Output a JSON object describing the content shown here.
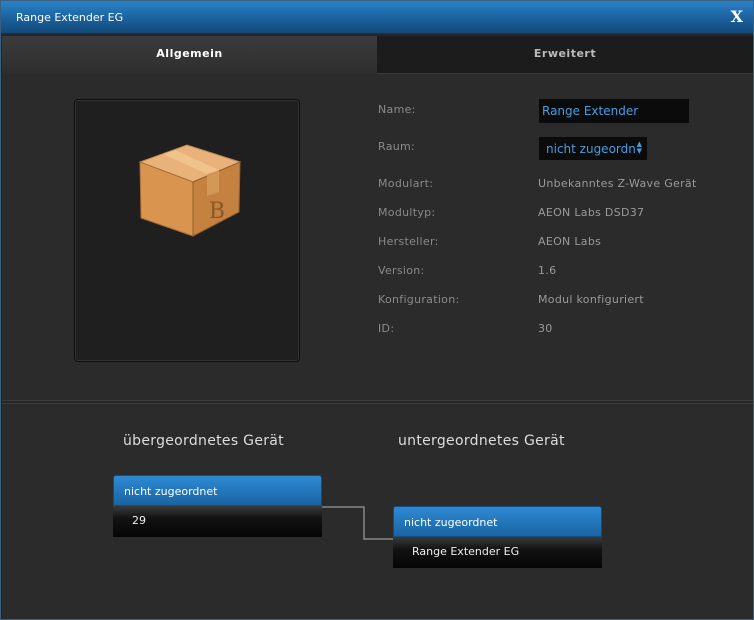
{
  "window": {
    "title": "Range Extender EG",
    "close_label": "X"
  },
  "tabs": [
    {
      "label": "Allgemein",
      "active": true
    },
    {
      "label": "Erweitert",
      "active": false
    }
  ],
  "icons": {
    "device_image": "package-box-icon"
  },
  "properties": {
    "name": {
      "label": "Name:",
      "value": "Range Extender"
    },
    "room": {
      "label": "Raum:",
      "value": "nicht zugeordn"
    },
    "modulart": {
      "label": "Modulart:",
      "value": "Unbekanntes Z-Wave Gerät"
    },
    "modultyp": {
      "label": "Modultyp:",
      "value": "AEON Labs DSD37"
    },
    "hersteller": {
      "label": "Hersteller:",
      "value": "AEON Labs"
    },
    "version": {
      "label": "Version:",
      "value": "1.6"
    },
    "konfiguration": {
      "label": "Konfiguration:",
      "value": "Modul konfiguriert"
    },
    "id": {
      "label": "ID:",
      "value": "30"
    }
  },
  "hierarchy": {
    "parent_heading": "übergeordnetes Gerät",
    "child_heading": "untergeordnetes Gerät",
    "parent_node": {
      "header": "nicht zugeordnet",
      "body": "29"
    },
    "child_node": {
      "header": "nicht zugeordnet",
      "body": "Range Extender EG"
    }
  },
  "colors": {
    "accent": "#1e74bb",
    "link_text": "#4a9de0",
    "background": "#2b2b2b"
  }
}
